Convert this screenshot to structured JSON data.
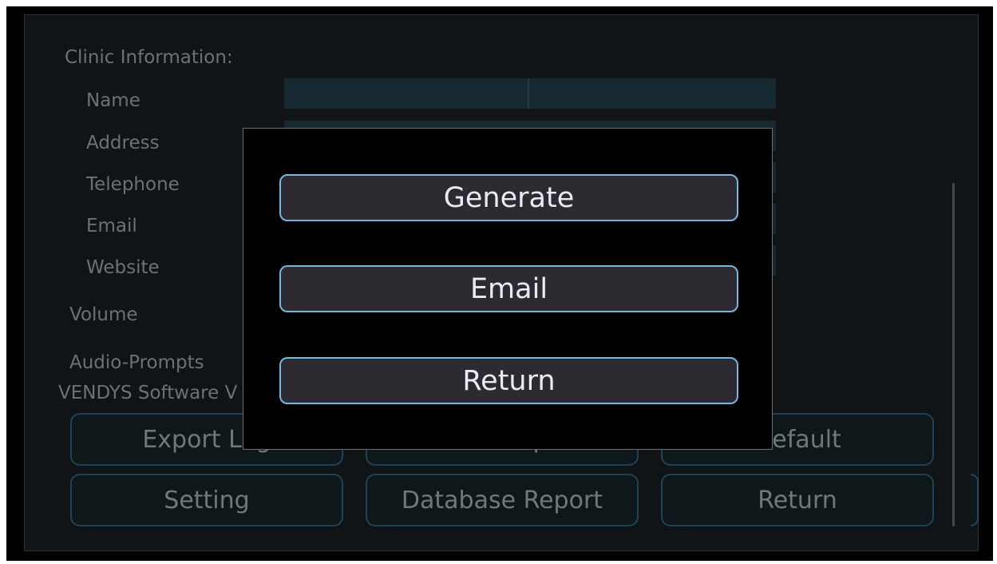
{
  "settings": {
    "clinic_info_heading": "Clinic Information:",
    "fields": [
      {
        "label": "Name"
      },
      {
        "label": "Address"
      },
      {
        "label": "Telephone"
      },
      {
        "label": "Email"
      },
      {
        "label": "Website"
      }
    ],
    "volume_label": "Volume",
    "audio_prompts_label": "Audio-Prompts",
    "software_version_label": "VENDYS Software V"
  },
  "buttons": {
    "export_log": "Export Log",
    "software_update": "Software Update",
    "default": "Default",
    "setting": "Setting",
    "database_report": "Database Report",
    "return": "Return"
  },
  "dialog": {
    "generate": "Generate",
    "email": "Email",
    "return": "Return"
  },
  "colors": {
    "field_fill": "#1d3a47",
    "button_border": "#2b6a8c",
    "dialog_button_border": "#74b7e3",
    "dialog_button_fill": "#2e2a31"
  }
}
